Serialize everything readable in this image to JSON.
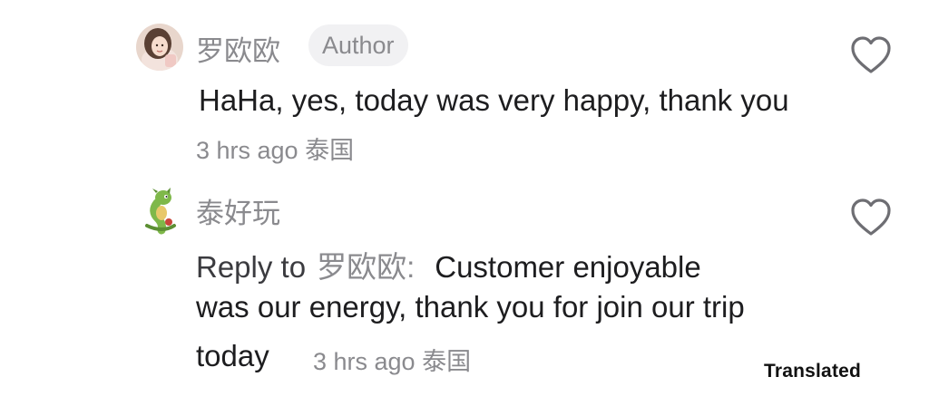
{
  "comments": [
    {
      "username": "罗欧欧",
      "badge": "Author",
      "avatar": "user-photo-avatar",
      "text": "HaHa, yes, today was very happy, thank you",
      "time": "3 hrs ago",
      "location": "泰国",
      "like_icon": "heart-outline-icon"
    },
    {
      "username": "泰好玩",
      "avatar": "green-dragon-avatar",
      "reply_prefix": "Reply to",
      "reply_target": "罗欧欧",
      "reply_colon": ":",
      "text_line1": "Customer enjoyable",
      "text_line2": "was our energy, thank you for join our trip",
      "text_line3": "today",
      "time": "3 hrs ago",
      "location": "泰国",
      "like_icon": "heart-outline-icon"
    }
  ],
  "footer": {
    "translated_label": "Translated"
  },
  "colors": {
    "primary_text": "#1d1d1f",
    "secondary_text": "#8a8a8e",
    "badge_bg": "#f1f1f3",
    "heart_stroke": "#6e6e73"
  }
}
